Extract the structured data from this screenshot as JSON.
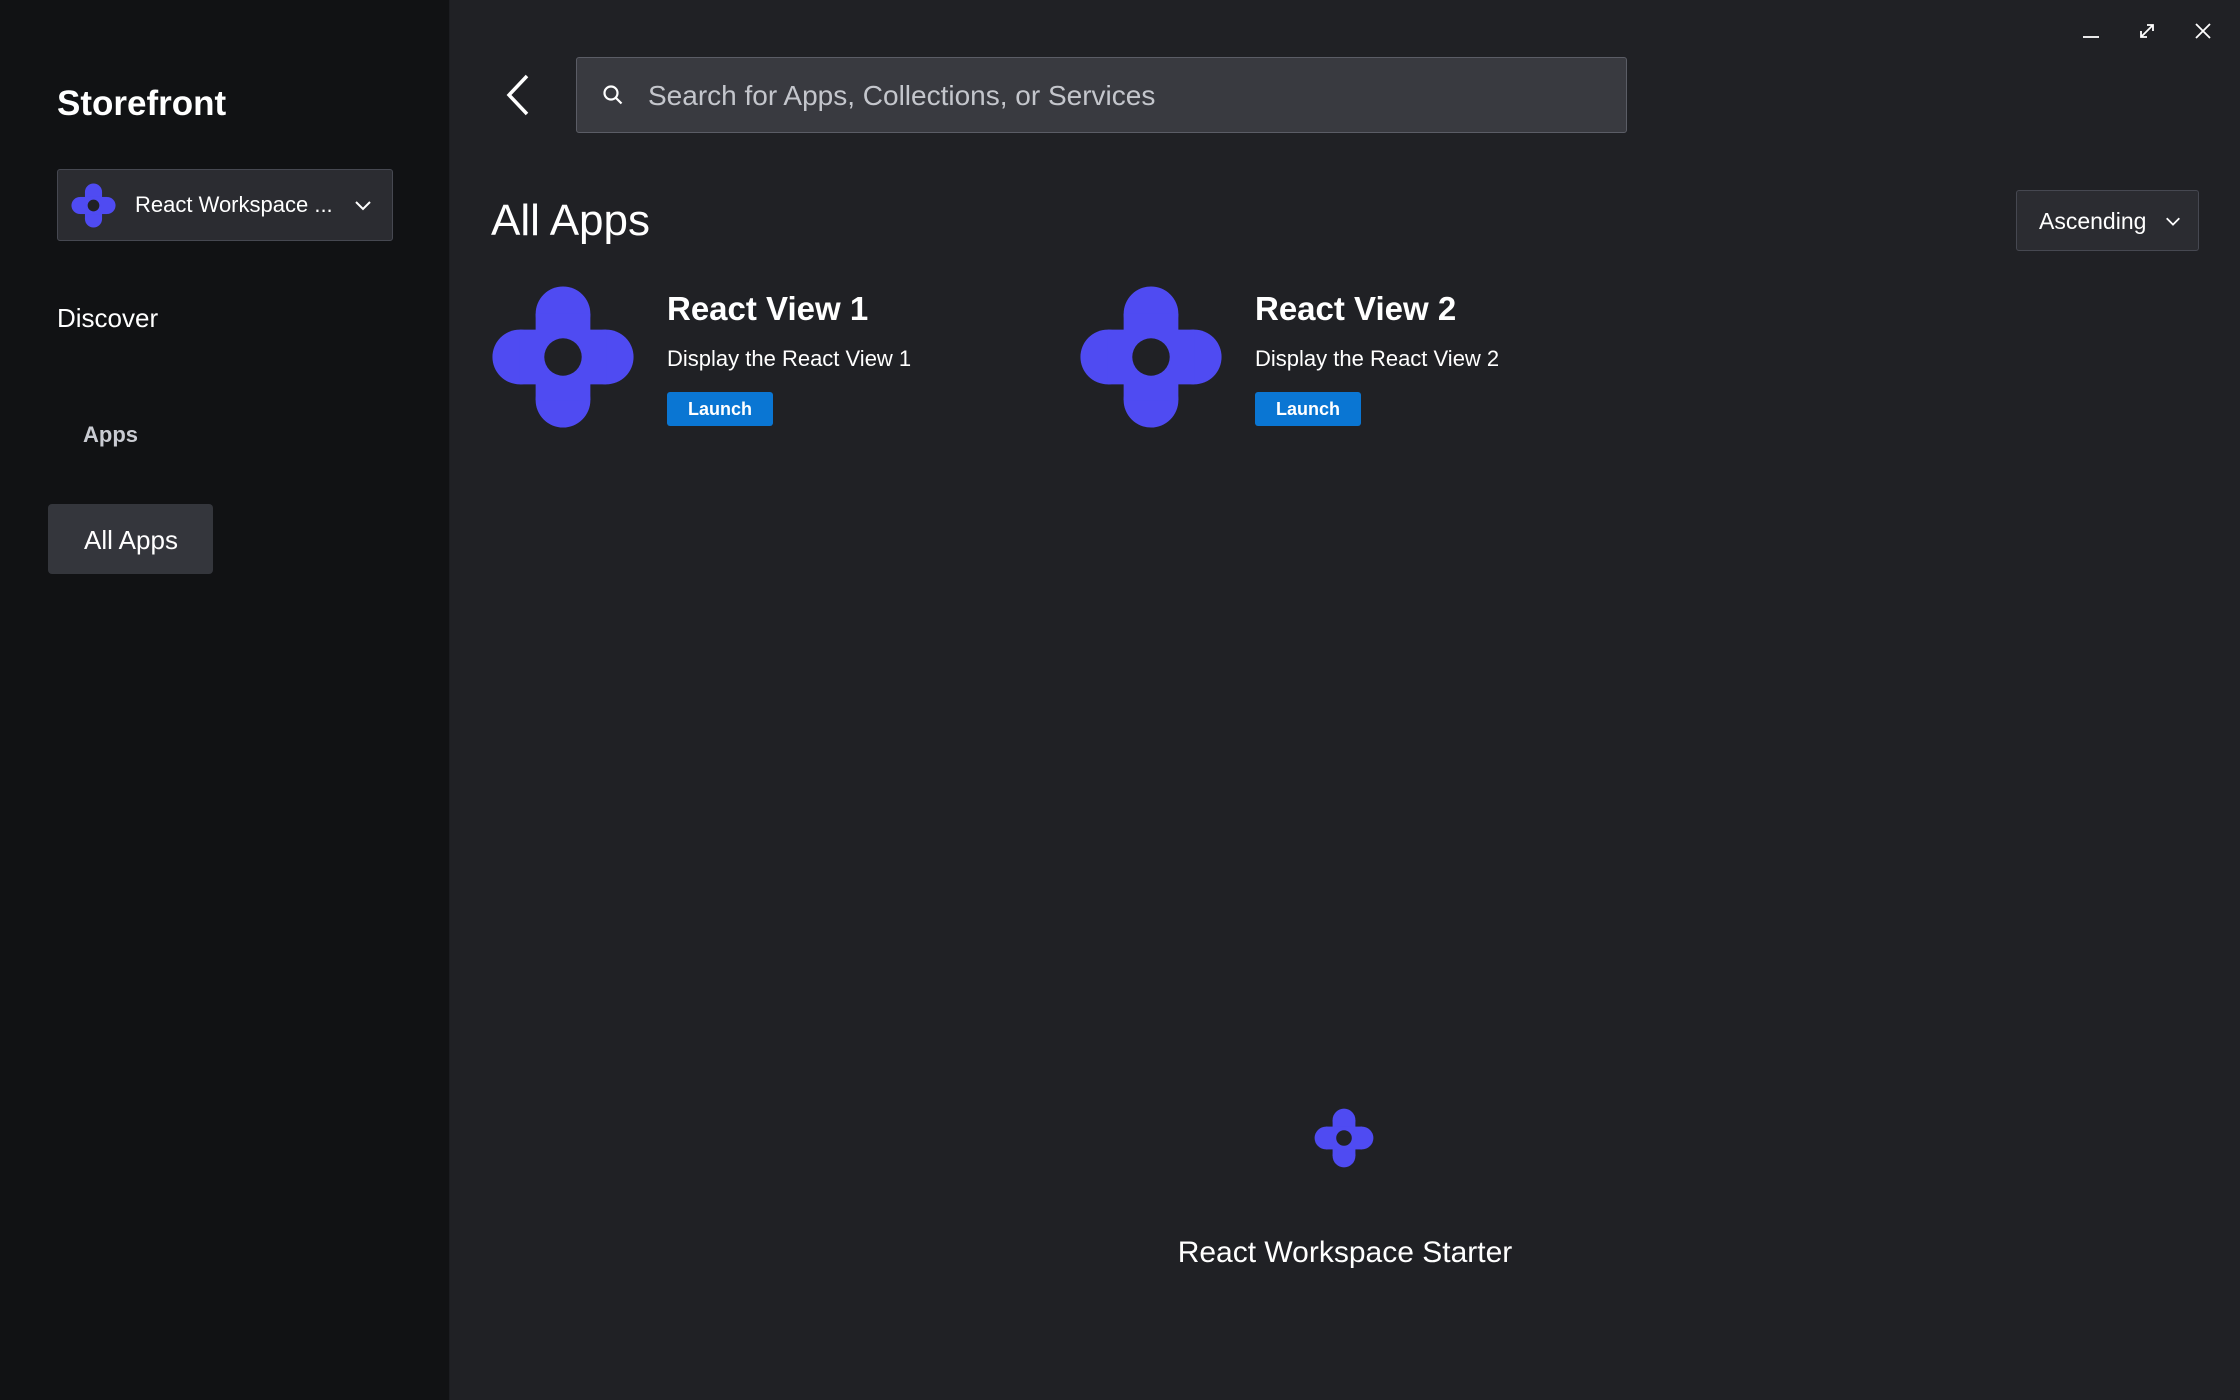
{
  "window": {
    "controls": [
      "minimize-icon",
      "maximize-icon",
      "close-icon"
    ]
  },
  "sidebar": {
    "title": "Storefront",
    "workspace_selector": {
      "label": "React Workspace ...",
      "icon": "workspace-logo-icon"
    },
    "items": [
      {
        "label": "Discover"
      },
      {
        "label": "Apps",
        "type": "section-header"
      },
      {
        "label": "All Apps",
        "selected": true
      }
    ]
  },
  "header": {
    "search": {
      "placeholder": "Search for Apps, Collections, or Services",
      "value": ""
    },
    "back_icon": "chevron-left-icon"
  },
  "main": {
    "title": "All Apps",
    "sort": {
      "selected": "Ascending"
    },
    "apps": [
      {
        "name": "React View 1",
        "description": "Display the React View 1",
        "action": "Launch",
        "icon": "workspace-logo-icon"
      },
      {
        "name": "React View 2",
        "description": "Display the React View 2",
        "action": "Launch",
        "icon": "workspace-logo-icon"
      }
    ]
  },
  "footer": {
    "title": "React Workspace Starter"
  },
  "colors": {
    "background": "#202125",
    "sidebar": "#111214",
    "brand_logo": "#4f4bf2",
    "launch_button": "#0a76d3",
    "selected_nav": "#34363c"
  }
}
